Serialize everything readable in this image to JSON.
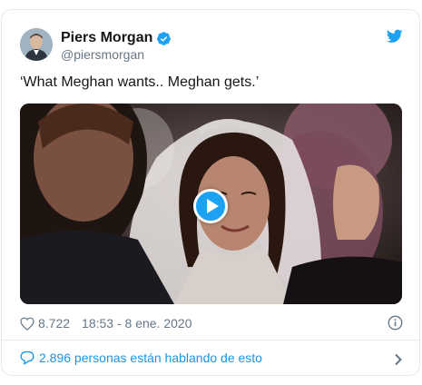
{
  "author": {
    "name": "Piers Morgan",
    "handle": "@piersmorgan",
    "verified": true
  },
  "tweet": {
    "text": "‘What Meghan wants.. Meghan gets.’"
  },
  "media": {
    "type": "video",
    "play_icon": "play-icon"
  },
  "meta": {
    "likes": "8.722",
    "timestamp": "18:53 - 8 ene. 2020"
  },
  "conversation": {
    "label": "2.896 personas están hablando de esto"
  },
  "icons": {
    "verified": "verified-badge-icon",
    "brand": "twitter-bird-icon",
    "like": "heart-icon",
    "info": "info-icon",
    "reply": "speech-bubble-icon",
    "more": "chevron-right-icon"
  },
  "colors": {
    "accent": "#1da1f2",
    "link": "#1b95e0",
    "muted": "#657786",
    "border": "#e1e8ed"
  }
}
